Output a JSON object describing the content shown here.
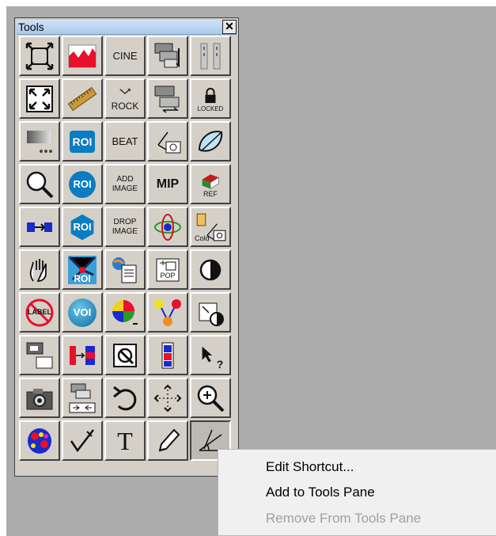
{
  "window": {
    "title": "Tools",
    "close_glyph": "✕"
  },
  "tools": [
    {
      "name": "zoom-fit-icon",
      "text": ""
    },
    {
      "name": "histogram-icon",
      "text": ""
    },
    {
      "name": "cine-button",
      "text": "CINE"
    },
    {
      "name": "stack-arrange-icon",
      "text": ""
    },
    {
      "name": "parallel-bars-icon",
      "text": ""
    },
    {
      "name": "fullscreen-icon",
      "text": ""
    },
    {
      "name": "ruler-icon",
      "text": ""
    },
    {
      "name": "rock-button",
      "text": "ROCK"
    },
    {
      "name": "stack-swap-icon",
      "text": ""
    },
    {
      "name": "locked-button",
      "text": "LOCKED"
    },
    {
      "name": "gradient-dots-icon",
      "text": ""
    },
    {
      "name": "roi-square-button",
      "text": "ROI"
    },
    {
      "name": "beat-button",
      "text": "BEAT"
    },
    {
      "name": "measure-camera-icon",
      "text": ""
    },
    {
      "name": "shape-edit-icon",
      "text": ""
    },
    {
      "name": "magnifier-icon",
      "text": ""
    },
    {
      "name": "roi-circle-button",
      "text": "ROI"
    },
    {
      "name": "add-image-button",
      "text": "ADD IMAGE"
    },
    {
      "name": "mip-button",
      "text": "MIP"
    },
    {
      "name": "ref-button",
      "text": "REF"
    },
    {
      "name": "link-arrows-icon",
      "text": ""
    },
    {
      "name": "roi-hex-button",
      "text": "ROI"
    },
    {
      "name": "drop-image-button",
      "text": "DROP IMAGE"
    },
    {
      "name": "rotate-3d-icon",
      "text": ""
    },
    {
      "name": "cold-camera-icon",
      "text": "Cold"
    },
    {
      "name": "hand-pan-icon",
      "text": ""
    },
    {
      "name": "roi-burst-button",
      "text": "ROI"
    },
    {
      "name": "document-globe-icon",
      "text": ""
    },
    {
      "name": "pop-button",
      "text": "POP"
    },
    {
      "name": "contrast-icon",
      "text": ""
    },
    {
      "name": "no-label-button",
      "text": "LABEL"
    },
    {
      "name": "voi-button",
      "text": "VOI"
    },
    {
      "name": "color-wheel-icon",
      "text": ""
    },
    {
      "name": "merge-colors-icon",
      "text": ""
    },
    {
      "name": "window-contrast-icon",
      "text": ""
    },
    {
      "name": "layout-panels-icon",
      "text": ""
    },
    {
      "name": "color-bars-arrow-icon",
      "text": ""
    },
    {
      "name": "image-tool-icon",
      "text": ""
    },
    {
      "name": "colorbar-icon",
      "text": ""
    },
    {
      "name": "help-pointer-icon",
      "text": "?"
    },
    {
      "name": "camera-icon",
      "text": ""
    },
    {
      "name": "stack-split-icon",
      "text": ""
    },
    {
      "name": "undo-icon",
      "text": ""
    },
    {
      "name": "move-arrows-icon",
      "text": ""
    },
    {
      "name": "zoom-in-icon",
      "text": ""
    },
    {
      "name": "brain-map-icon",
      "text": ""
    },
    {
      "name": "checkmark-pen-icon",
      "text": ""
    },
    {
      "name": "text-tool-icon",
      "text": "T"
    },
    {
      "name": "pencil-icon",
      "text": ""
    },
    {
      "name": "angle-tool-icon",
      "text": ""
    }
  ],
  "context_menu": {
    "items": [
      {
        "label": "Edit Shortcut...",
        "enabled": true
      },
      {
        "label": "Add to Tools Pane",
        "enabled": true
      },
      {
        "label": "Remove From Tools Pane",
        "enabled": false
      }
    ]
  },
  "colors": {
    "desktop": "#acacac",
    "palette": "#d4d0c8",
    "menu": "#f0f0f0",
    "roi_blue": "#0c7cc2",
    "accent_red": "#e8102a"
  }
}
